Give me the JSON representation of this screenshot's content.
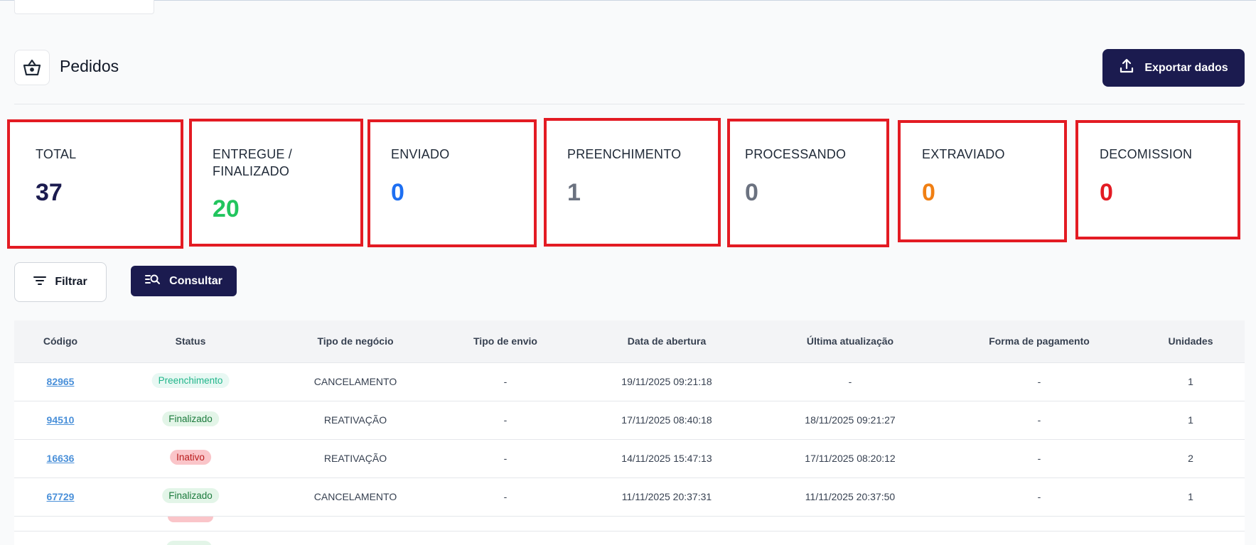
{
  "header": {
    "title": "Pedidos",
    "page_icon": "basket-icon",
    "export_label": "Exportar dados",
    "export_icon": "upload-icon"
  },
  "stats": [
    {
      "label": "TOTAL",
      "value": "37",
      "color": "#1b1b4f"
    },
    {
      "label": "ENTREGUE / FINALIZADO",
      "label_line1": "ENTREGUE /",
      "label_line2": "FINALIZADO",
      "value": "20",
      "color": "#22c55e"
    },
    {
      "label": "ENVIADO",
      "value": "0",
      "color": "#1d6ff2"
    },
    {
      "label": "PREENCHIMENTO",
      "value": "1",
      "color": "#6b7280"
    },
    {
      "label": "PROCESSANDO",
      "value": "0",
      "color": "#6b7280"
    },
    {
      "label": "EXTRAVIADO",
      "value": "0",
      "color": "#f07f13"
    },
    {
      "label": "DECOMISSION",
      "value": "0",
      "color": "#e31b23"
    }
  ],
  "actions": {
    "filter_label": "Filtrar",
    "filter_icon": "filter-icon",
    "query_label": "Consultar",
    "query_icon": "search-list-icon"
  },
  "table": {
    "columns": [
      "Código",
      "Status",
      "Tipo de negócio",
      "Tipo de envio",
      "Data de abertura",
      "Última atualização",
      "Forma de pagamento",
      "Unidades"
    ],
    "rows": [
      {
        "code": "82965",
        "status": "Preenchimento",
        "business": "CANCELAMENTO",
        "shipping": "-",
        "opened": "19/11/2025 09:21:18",
        "updated": "-",
        "payment": "-",
        "units": "1"
      },
      {
        "code": "94510",
        "status": "Finalizado",
        "business": "REATIVAÇÃO",
        "shipping": "-",
        "opened": "17/11/2025 08:40:18",
        "updated": "18/11/2025 09:21:27",
        "payment": "-",
        "units": "1"
      },
      {
        "code": "16636",
        "status": "Inativo",
        "business": "REATIVAÇÃO",
        "shipping": "-",
        "opened": "14/11/2025 15:47:13",
        "updated": "17/11/2025 08:20:12",
        "payment": "-",
        "units": "2"
      },
      {
        "code": "67729",
        "status": "Finalizado",
        "business": "CANCELAMENTO",
        "shipping": "-",
        "opened": "11/11/2025 20:37:31",
        "updated": "11/11/2025 20:37:50",
        "payment": "-",
        "units": "1"
      }
    ]
  },
  "colors": {
    "brand_dark": "#1b1b4f",
    "highlight_border": "#e31b23",
    "link": "#4a90d9"
  }
}
